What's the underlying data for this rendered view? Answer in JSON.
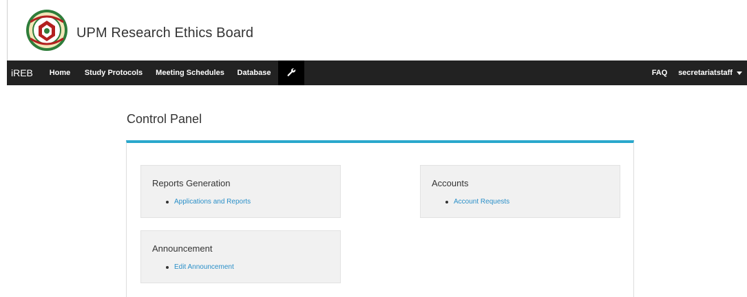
{
  "header": {
    "site_title": "UPM Research Ethics Board",
    "logo_icon": "university-seal-icon"
  },
  "navbar": {
    "brand": "iREB",
    "items": [
      {
        "label": "Home"
      },
      {
        "label": "Study Protocols"
      },
      {
        "label": "Meeting Schedules"
      },
      {
        "label": "Database"
      },
      {
        "label": "",
        "icon": "wrench-icon",
        "active": true
      }
    ],
    "right_items": [
      {
        "label": "FAQ"
      },
      {
        "label": "secretariatstaff",
        "icon": "caret-down-icon"
      }
    ]
  },
  "main": {
    "heading": "Control Panel",
    "sections": [
      {
        "title": "Reports Generation",
        "links": [
          "Applications and Reports"
        ]
      },
      {
        "title": "Accounts",
        "links": [
          "Account Requests"
        ]
      },
      {
        "title": "Announcement",
        "links": [
          "Edit Announcement"
        ]
      }
    ]
  },
  "colors": {
    "navbar_bg": "#222222",
    "panel_accent": "#2aa8cc",
    "link": "#2a8fc8",
    "box_bg": "#f1f1f1"
  }
}
